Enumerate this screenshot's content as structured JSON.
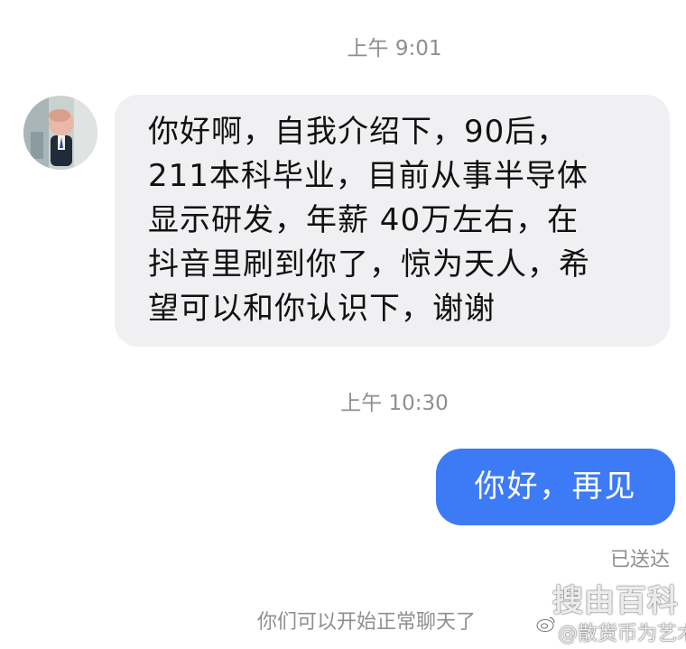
{
  "chat": {
    "timestamp_1": "上午 9:01",
    "timestamp_2": "上午 10:30",
    "incoming_message": {
      "lines": [
        "你好啊，自我介绍下，90后，",
        "211本科毕业，目前从事半导体",
        "显示研发，年薪 40万左右，在",
        "抖音里刷到你了，惊为天人，希",
        "望可以和你认识下，谢谢"
      ]
    },
    "outgoing_message": "你好，再见",
    "delivery_status": "已送达",
    "system_note": "你们可以开始正常聊天了"
  },
  "watermark": {
    "top": "搜由百科",
    "bottom": "@散货币为艺术",
    "logo_icon": "weibo-logo-icon"
  },
  "colors": {
    "outgoing_bubble": "#3d7bf6",
    "incoming_bubble": "#f0f0f2",
    "meta_text": "#8e8e93"
  }
}
